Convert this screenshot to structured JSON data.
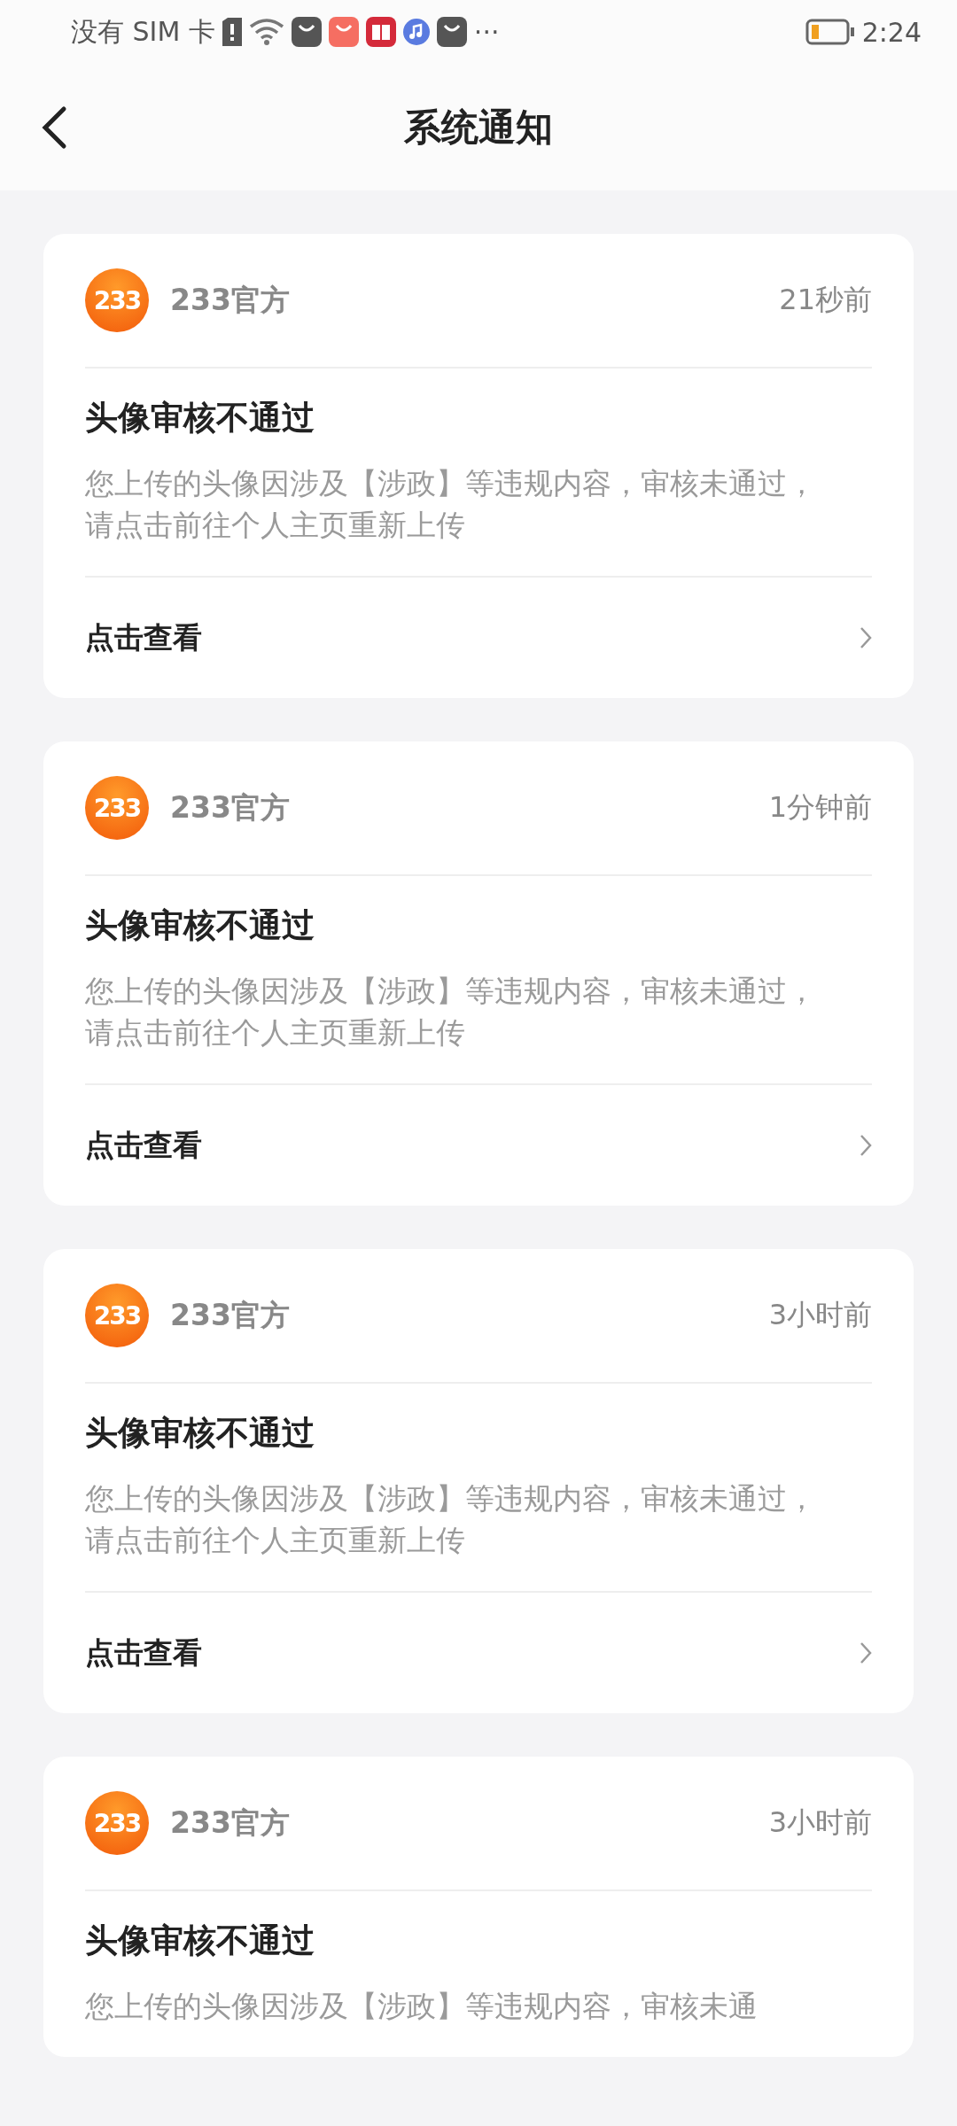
{
  "status_bar": {
    "carrier": "没有 SIM 卡",
    "more": "···",
    "time": "2:24"
  },
  "nav": {
    "title": "系统通知"
  },
  "notifications": [
    {
      "sender": "233官方",
      "logo": "233",
      "time": "21秒前",
      "title": "头像审核不通过",
      "body": "您上传的头像因涉及【涉政】等违规内容，审核未通过，请点击前往个人主页重新上传",
      "action": "点击查看"
    },
    {
      "sender": "233官方",
      "logo": "233",
      "time": "1分钟前",
      "title": "头像审核不通过",
      "body": "您上传的头像因涉及【涉政】等违规内容，审核未通过，请点击前往个人主页重新上传",
      "action": "点击查看"
    },
    {
      "sender": "233官方",
      "logo": "233",
      "time": "3小时前",
      "title": "头像审核不通过",
      "body": "您上传的头像因涉及【涉政】等违规内容，审核未通过，请点击前往个人主页重新上传",
      "action": "点击查看"
    },
    {
      "sender": "233官方",
      "logo": "233",
      "time": "3小时前",
      "title": "头像审核不通过",
      "body": "您上传的头像因涉及【涉政】等违规内容，审核未通"
    }
  ]
}
